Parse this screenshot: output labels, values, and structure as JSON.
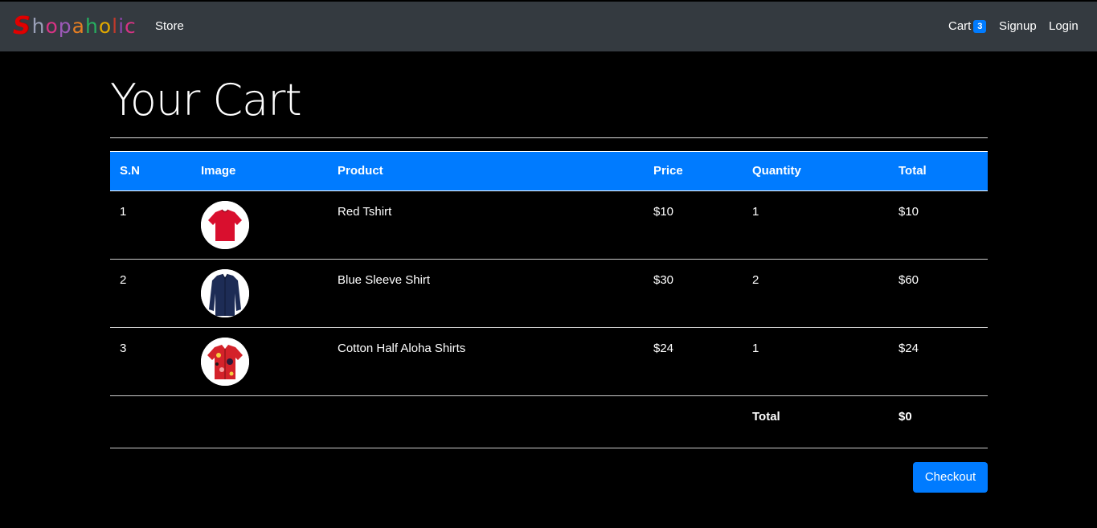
{
  "nav": {
    "brand_letters": [
      {
        "char": "S",
        "color": "#e00000"
      },
      {
        "char": "h",
        "color": "#9aa0b8"
      },
      {
        "char": "o",
        "color": "#d63384"
      },
      {
        "char": "p",
        "color": "#9b59b6"
      },
      {
        "char": "a",
        "color": "#e67e22"
      },
      {
        "char": "h",
        "color": "#27ae60"
      },
      {
        "char": "o",
        "color": "#e0a800"
      },
      {
        "char": "l",
        "color": "#c0392b"
      },
      {
        "char": "i",
        "color": "#8e44ad"
      },
      {
        "char": "c",
        "color": "#d63384"
      }
    ],
    "store": "Store",
    "cart": "Cart",
    "cart_count": "3",
    "signup": "Signup",
    "login": "Login"
  },
  "page_title": "Your Cart",
  "table": {
    "headers": {
      "sn": "S.N",
      "image": "Image",
      "product": "Product",
      "price": "Price",
      "quantity": "Quantity",
      "total": "Total"
    },
    "rows": [
      {
        "sn": "1",
        "image_icon": "red-tshirt",
        "product": "Red Tshirt",
        "price": "$10",
        "quantity": "1",
        "total": "$10"
      },
      {
        "sn": "2",
        "image_icon": "blue-sleeve-shirt",
        "product": "Blue Sleeve Shirt",
        "price": "$30",
        "quantity": "2",
        "total": "$60"
      },
      {
        "sn": "3",
        "image_icon": "aloha-shirt",
        "product": "Cotton Half Aloha Shirts",
        "price": "$24",
        "quantity": "1",
        "total": "$24"
      }
    ],
    "footer": {
      "label": "Total",
      "value": "$0"
    }
  },
  "checkout_label": "Checkout",
  "colors": {
    "navbar": "#343a40",
    "accent": "#007bff",
    "background": "#000000"
  }
}
